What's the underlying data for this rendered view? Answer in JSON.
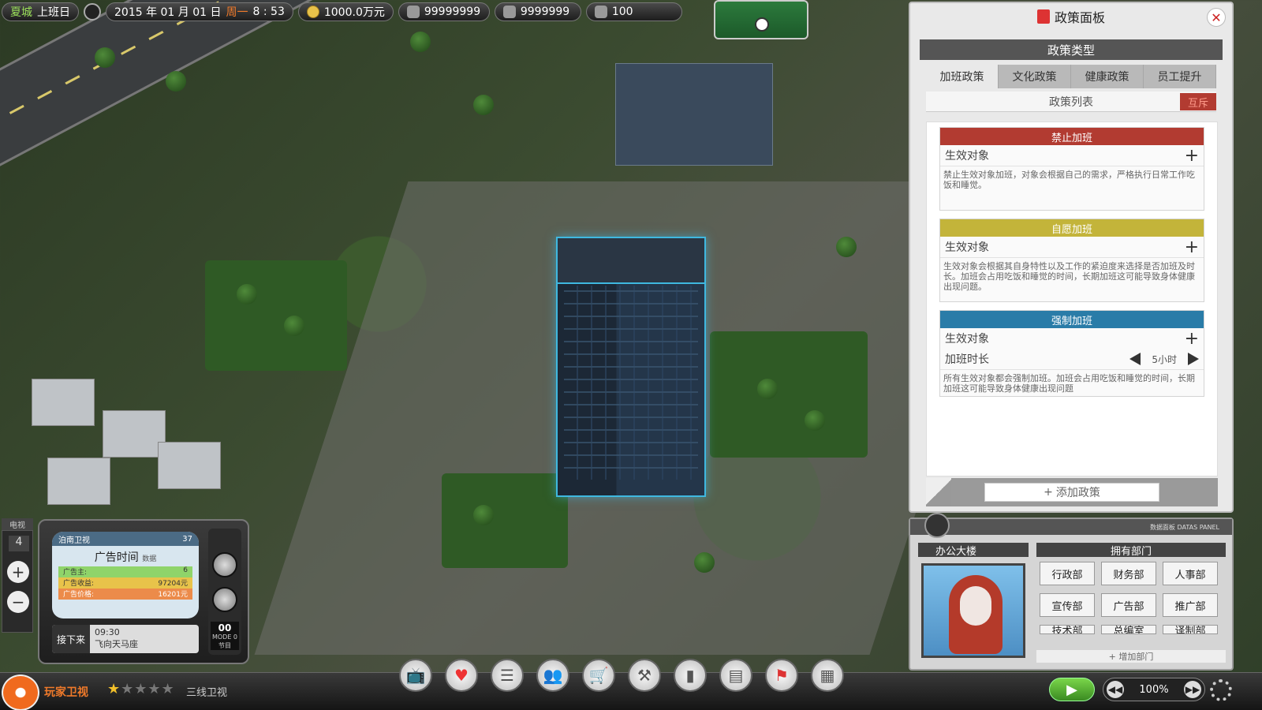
{
  "topbar": {
    "city": "夏城",
    "work_status": "上班日",
    "date": "2015 年 01 月 01 日",
    "weekday": "周一",
    "time": "8 : 53",
    "money": "1000.0万元",
    "resource1": "99999999",
    "resource2": "9999999",
    "resource3": "100"
  },
  "policy_panel": {
    "title": "政策面板",
    "close_label": "✕",
    "type_header": "政策类型",
    "tabs": [
      {
        "label": "加班政策",
        "active": true
      },
      {
        "label": "文化政策",
        "active": false
      },
      {
        "label": "健康政策",
        "active": false
      },
      {
        "label": "员工提升",
        "active": false
      }
    ],
    "list_header": "政策列表",
    "mutex_label": "互斥",
    "cards": [
      {
        "title": "禁止加班",
        "color": "#b23b31",
        "target_label": "生效对象",
        "desc": "禁止生效对象加班，对象会根据自己的需求，严格执行日常工作吃饭和睡觉。"
      },
      {
        "title": "自愿加班",
        "color": "#c3b43a",
        "target_label": "生效对象",
        "desc": "生效对象会根据其自身特性以及工作的紧迫度来选择是否加班及时长。加班会占用吃饭和睡觉的时间，长期加班这可能导致身体健康出现问题。"
      },
      {
        "title": "强制加班",
        "color": "#2a7ca8",
        "target_label": "生效对象",
        "duration_label": "加班时长",
        "duration_value": "5小时",
        "desc": "所有生效对象都会强制加班。加班会占用吃饭和睡觉的时间，长期加班这可能导致身体健康出现问题"
      }
    ],
    "add_policy_label": "添加政策"
  },
  "info_panel": {
    "strip_text": "数据面板 DATAS PANEL",
    "building_name": "办公大楼",
    "dept_title": "拥有部门",
    "departments": [
      "行政部",
      "财务部",
      "人事部",
      "宣传部",
      "广告部",
      "推广部",
      "技术部",
      "总编室",
      "译制部"
    ],
    "add_dept_label": "增加部门"
  },
  "tv": {
    "tag": "电视",
    "channel_number": "4",
    "channel": "泊南卫视",
    "viewers": "37",
    "ad_title": "广告时间",
    "data_label": "数据",
    "rows": [
      {
        "label": "广告主:",
        "value": "6"
      },
      {
        "label": "广告收益:",
        "value": "97204元"
      },
      {
        "label": "广告价格:",
        "value": "16201元"
      }
    ],
    "next_label": "接下来",
    "next_time": "09:30",
    "next_program": "飞向天马座",
    "mode_value": "00",
    "mode_label": "MODE 0",
    "mode_sub": "节目"
  },
  "bottombar": {
    "channel_name": "玩家卫视",
    "stars_on": 1,
    "stars_total": 5,
    "tier": "三线卫视",
    "speed": "100%"
  }
}
